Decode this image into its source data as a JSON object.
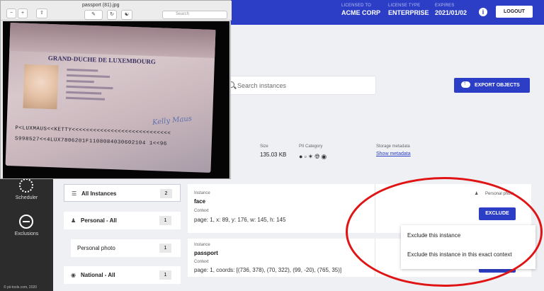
{
  "header": {
    "license": [
      {
        "label": "LICENSED TO",
        "value": "ACME CORP"
      },
      {
        "label": "LICENSE TYPE",
        "value": "ENTERPRISE"
      },
      {
        "label": "EXPIRES",
        "value": "2021/01/02"
      }
    ],
    "info_glyph": "i",
    "logout_label": "LOGOUT",
    "accent_color": "#2c3ec6"
  },
  "toolbar": {
    "search_placeholder": "Search instances",
    "export_label": "EXPORT OBJECTS"
  },
  "metadata": {
    "size_label": "Size",
    "size_value": "135.03 KB",
    "pii_label": "PII Category",
    "pii_icons": [
      "person-icon",
      "id-card-icon",
      "fingerprint-icon",
      "globe-icon",
      "globe-filled-icon"
    ],
    "storage_label": "Storage metadata",
    "storage_link": "Show metadata"
  },
  "sidebar": {
    "items": [
      {
        "label": "Scheduler",
        "icon": "scheduler-icon"
      },
      {
        "label": "Exclusions",
        "icon": "minus-circle-icon"
      }
    ],
    "copyright": "© pii-tools.com, 2020"
  },
  "filters": [
    {
      "label": "All Instances",
      "count": "2",
      "icon": "list-icon"
    },
    {
      "label": "Personal - All",
      "count": "1",
      "icon": "person-icon"
    },
    {
      "label": "Personal photo",
      "count": "1",
      "icon": ""
    },
    {
      "label": "National - All",
      "count": "1",
      "icon": "globe-icon"
    }
  ],
  "instances": [
    {
      "instance_label": "Instance",
      "value": "face",
      "context_label": "Context",
      "context": "page: 1, x: 89, y: 176, w: 145, h: 145",
      "category": "Personal photo",
      "exclude_label": "EXCLUDE"
    },
    {
      "instance_label": "Instance",
      "value": "passport",
      "context_label": "Context",
      "context": "page: 1, coords: [(736, 378), (70, 322), (99, -20), (765, 35)]"
    }
  ],
  "exclude_menu": [
    "Exclude this instance",
    "Exclude this instance in this exact context"
  ],
  "preview": {
    "filename": "passport (81).jpg",
    "search_placeholder": "Search",
    "doc_title": "GRAND-DUCHE DE LUXEMBOURG",
    "signature": "Kelly Maus",
    "mrz_line1": "P<LUXMAUS<<KETTY<<<<<<<<<<<<<<<<<<<<<<<<<<<<",
    "mrz_line2": "S998527<<4LUX7806201F1108084030602104 1<<96"
  }
}
